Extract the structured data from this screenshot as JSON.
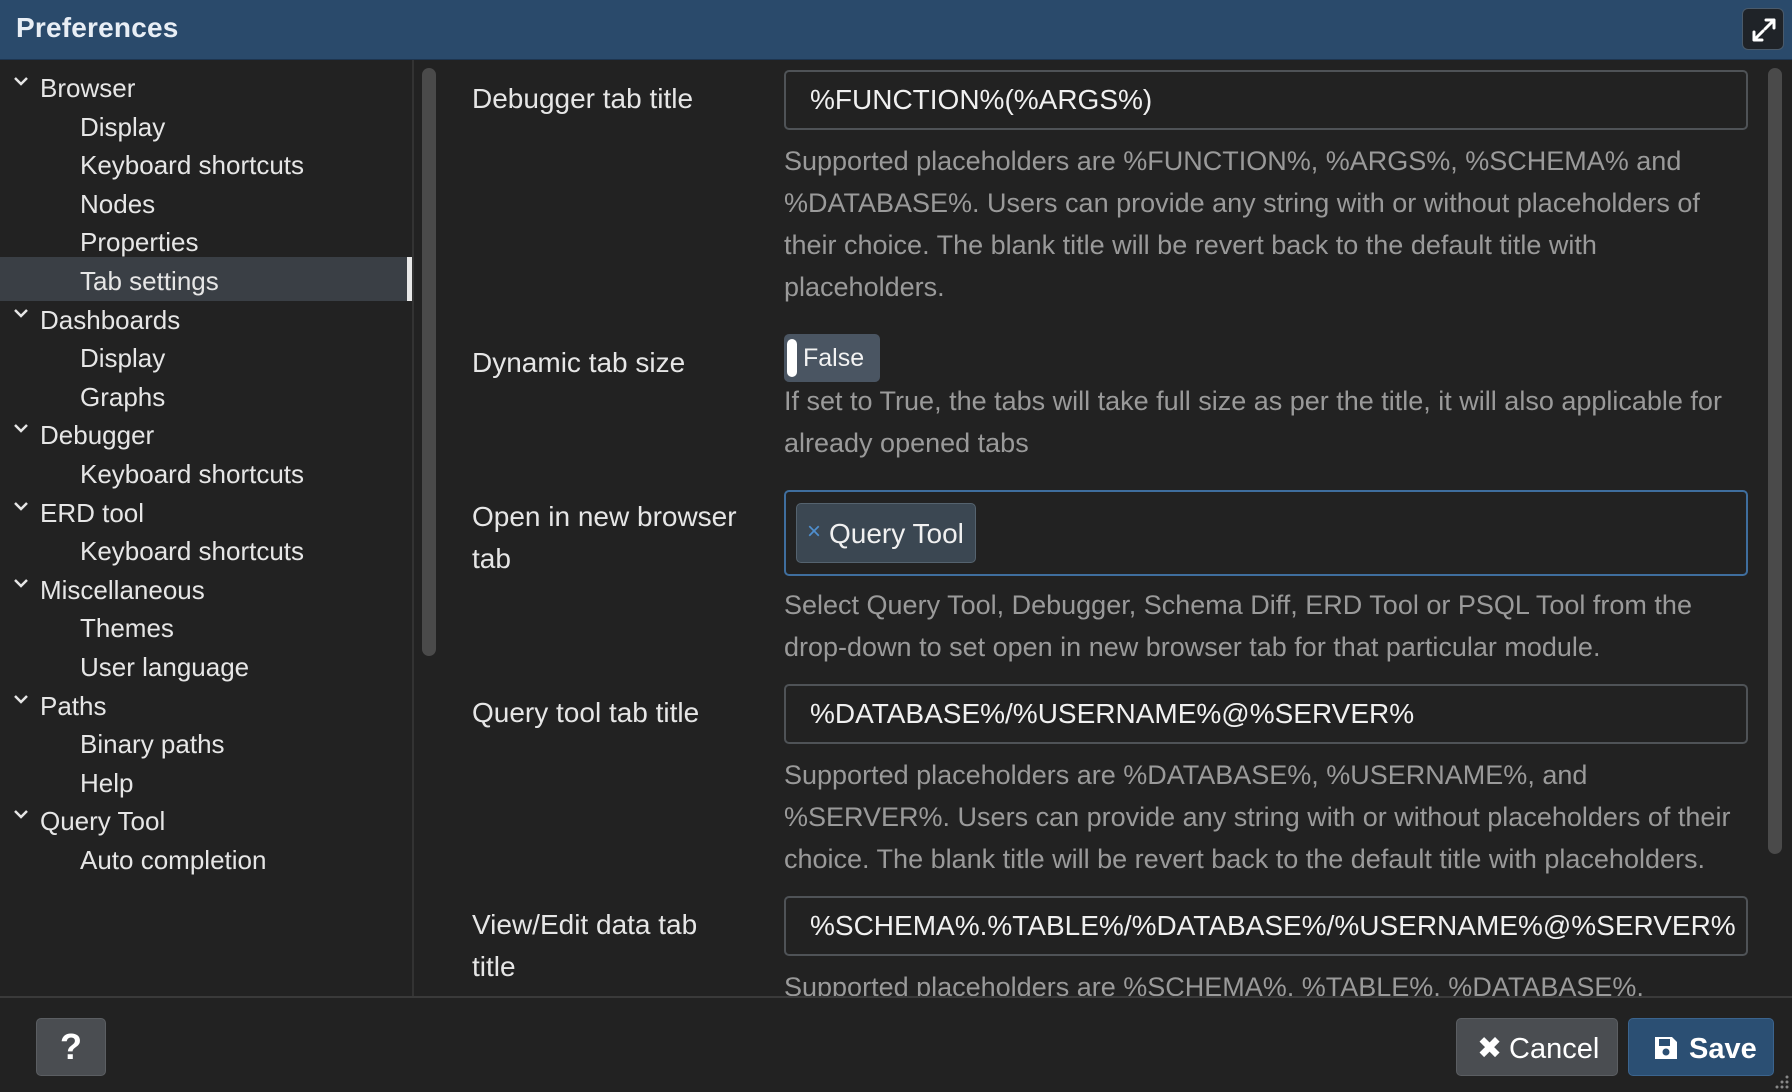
{
  "window": {
    "title": "Preferences"
  },
  "sidebar": {
    "items": [
      {
        "label": "Browser",
        "kind": "parent"
      },
      {
        "label": "Display",
        "kind": "child"
      },
      {
        "label": "Keyboard shortcuts",
        "kind": "child"
      },
      {
        "label": "Nodes",
        "kind": "child"
      },
      {
        "label": "Properties",
        "kind": "child"
      },
      {
        "label": "Tab settings",
        "kind": "child",
        "selected": true
      },
      {
        "label": "Dashboards",
        "kind": "parent"
      },
      {
        "label": "Display",
        "kind": "child"
      },
      {
        "label": "Graphs",
        "kind": "child"
      },
      {
        "label": "Debugger",
        "kind": "parent"
      },
      {
        "label": "Keyboard shortcuts",
        "kind": "child"
      },
      {
        "label": "ERD tool",
        "kind": "parent"
      },
      {
        "label": "Keyboard shortcuts",
        "kind": "child"
      },
      {
        "label": "Miscellaneous",
        "kind": "parent"
      },
      {
        "label": "Themes",
        "kind": "child"
      },
      {
        "label": "User language",
        "kind": "child"
      },
      {
        "label": "Paths",
        "kind": "parent"
      },
      {
        "label": "Binary paths",
        "kind": "child"
      },
      {
        "label": "Help",
        "kind": "child"
      },
      {
        "label": "Query Tool",
        "kind": "parent"
      },
      {
        "label": "Auto completion",
        "kind": "child"
      }
    ]
  },
  "settings": {
    "debugger_tab_title": {
      "label": "Debugger tab title",
      "value": "%FUNCTION%(%ARGS%)",
      "help": "Supported placeholders are %FUNCTION%, %ARGS%, %SCHEMA% and %DATABASE%. Users can provide any string with or without placeholders of their choice. The blank title will be revert back to the default title with placeholders."
    },
    "dynamic_tab_size": {
      "label": "Dynamic tab size",
      "value": "False",
      "help": "If set to True, the tabs will take full size as per the title, it will also applicable for already opened tabs"
    },
    "open_in_new_tab": {
      "label": "Open in new browser tab",
      "chips": [
        "Query Tool"
      ],
      "chip_remove": "×",
      "help": "Select Query Tool, Debugger, Schema Diff, ERD Tool or PSQL Tool from the drop-down to set open in new browser tab for that particular module."
    },
    "query_tool_tab_title": {
      "label": "Query tool tab title",
      "value": "%DATABASE%/%USERNAME%@%SERVER%",
      "help": "Supported placeholders are %DATABASE%, %USERNAME%, and %SERVER%. Users can provide any string with or without placeholders of their choice. The blank title will be revert back to the default title with placeholders."
    },
    "view_edit_tab_title": {
      "label": "View/Edit data tab title",
      "value": "%SCHEMA%.%TABLE%/%DATABASE%/%USERNAME%@%SERVER%",
      "help": "Supported placeholders are %SCHEMA%, %TABLE%, %DATABASE%,"
    }
  },
  "footer": {
    "help_label": "?",
    "cancel_label": "Cancel",
    "cancel_icon": "✖",
    "save_label": "Save"
  },
  "icons": {
    "expand": "expand-icon",
    "chevron": "chevron-down-icon",
    "save": "floppy-disk-icon",
    "cancel": "close-icon"
  },
  "colors": {
    "titlebar": "#2a4a6b",
    "background": "#222222",
    "accent": "#2b4f73",
    "focus_border": "#3f6e9e"
  }
}
